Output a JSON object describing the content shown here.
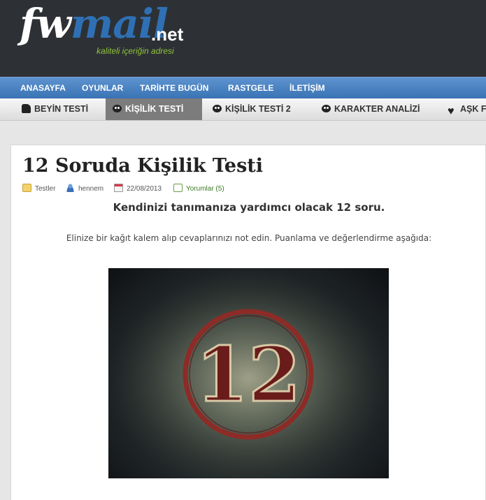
{
  "header": {
    "logo_fw": "fw",
    "logo_mail": "mail",
    "logo_net": ".net",
    "tagline": "kaliteli içeriğin adresi"
  },
  "nav_primary": {
    "items": [
      "ANASAYFA",
      "OYUNLAR",
      "TARİHTE BUGÜN",
      "RASTGELE",
      "İLETİŞİM"
    ]
  },
  "nav_secondary": {
    "items": [
      {
        "label": "BEYİN TESTİ",
        "icon": "brain-icon"
      },
      {
        "label": "KİŞİLİK TESTİ",
        "icon": "smiley-icon",
        "active": true
      },
      {
        "label": "KİŞİLİK TESTİ 2",
        "icon": "smiley-icon"
      },
      {
        "label": "KARAKTER ANALİZİ",
        "icon": "smiley-icon"
      },
      {
        "label": "AŞK F",
        "icon": "heart-icon"
      }
    ]
  },
  "article": {
    "title": "12 Soruda Kişilik Testi",
    "meta": {
      "category": "Testler",
      "author": "hennem",
      "date": "22/08/2013",
      "comments": "Yorumlar (5)"
    },
    "lead": "Kendinizi tanımanıza yardımcı olacak 12 soru.",
    "paragraph": "Elinize bir kağıt kalem alıp cevaplarınızı not edin. Puanlama ve değerlendirme aşağıda:",
    "image_number": "12"
  },
  "colors": {
    "header_bg": "#2d3135",
    "nav_blue": "#3a73b4",
    "tagline_green": "#8fc43a",
    "active_tab": "#7c7c7c"
  }
}
